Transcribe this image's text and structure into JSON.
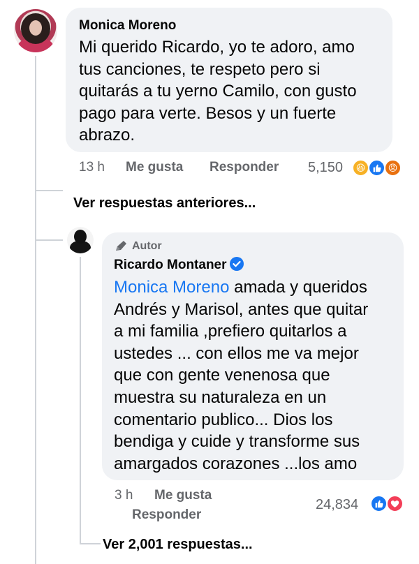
{
  "comment1": {
    "author": "Monica Moreno",
    "lines": [
      "Mi querido Ricardo, yo te adoro, amo",
      "tus canciones, te respeto pero si",
      "quitarás a tu yerno Camilo, con gusto",
      "pago para verte. Besos y un fuerte",
      "abrazo."
    ],
    "time": "13 h",
    "like_label": "Me gusta",
    "reply_label": "Responder",
    "reaction_count": "5,150",
    "reactions": [
      "haha-icon",
      "like-icon",
      "angry-icon"
    ]
  },
  "previous_replies": "Ver respuestas anteriores...",
  "comment2": {
    "badge": "Autor",
    "author": "Ricardo Montaner",
    "verified": true,
    "mention": "Monica Moreno",
    "first_line_rest": " amada y queridos",
    "lines": [
      "Andrés y Marisol, antes que quitar",
      "a mi familia ,prefiero quitarlos a",
      "ustedes ... con ellos me va mejor",
      "que con gente venenosa que",
      "muestra su naturaleza en un",
      "comentario publico... Dios los",
      "bendiga y cuide y transforme sus",
      "amargados corazones ...los amo"
    ],
    "time": "3 h",
    "like_label": "Me gusta",
    "reply_label": "Responder",
    "reaction_count": "24,834",
    "reactions": [
      "like-icon",
      "love-icon"
    ]
  },
  "more_replies": "Ver 2,001 respuestas...",
  "colors": {
    "bubble": "#f0f2f5",
    "link": "#1877f2",
    "meta": "#65676b"
  }
}
